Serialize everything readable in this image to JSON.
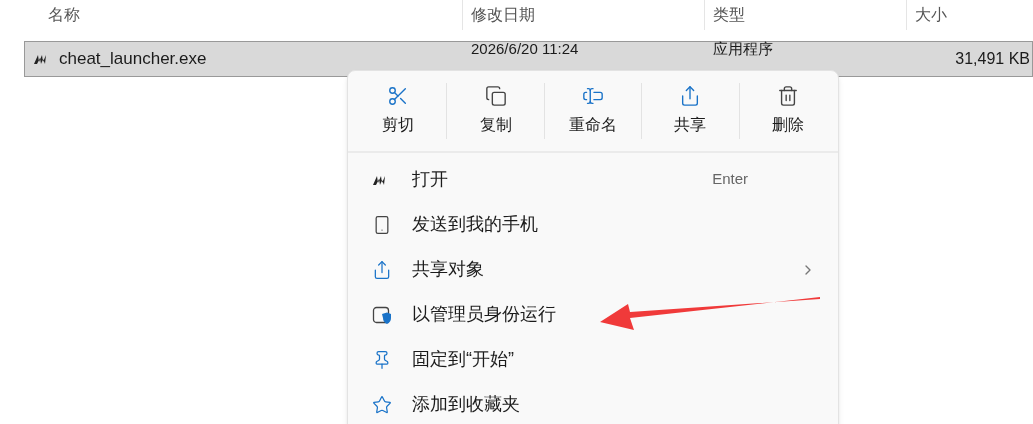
{
  "columns": [
    "名称",
    "修改日期",
    "类型",
    "大小"
  ],
  "files": [
    {
      "name": "cheat_launcher.exe",
      "modified": "2026/6/20 11:24",
      "type": "应用程序",
      "size": "31,491 KB",
      "selected": true
    }
  ],
  "context_menu": {
    "toolbar": [
      {
        "kind": "cut",
        "label": "剪切"
      },
      {
        "kind": "copy",
        "label": "复制"
      },
      {
        "kind": "rename",
        "label": "重命名"
      },
      {
        "kind": "share",
        "label": "共享"
      },
      {
        "kind": "delete",
        "label": "删除"
      }
    ],
    "items": [
      {
        "kind": "app",
        "label": "打开",
        "shortcut": "Enter",
        "submenu": false
      },
      {
        "kind": "phone",
        "label": "发送到我的手机",
        "submenu": false
      },
      {
        "kind": "share",
        "label": "共享对象",
        "submenu": true
      },
      {
        "kind": "admin",
        "label": "以管理员身份运行",
        "submenu": false
      },
      {
        "kind": "pin",
        "label": "固定到“开始”",
        "submenu": false
      },
      {
        "kind": "star",
        "label": "添加到收藏夹",
        "submenu": false
      }
    ]
  }
}
